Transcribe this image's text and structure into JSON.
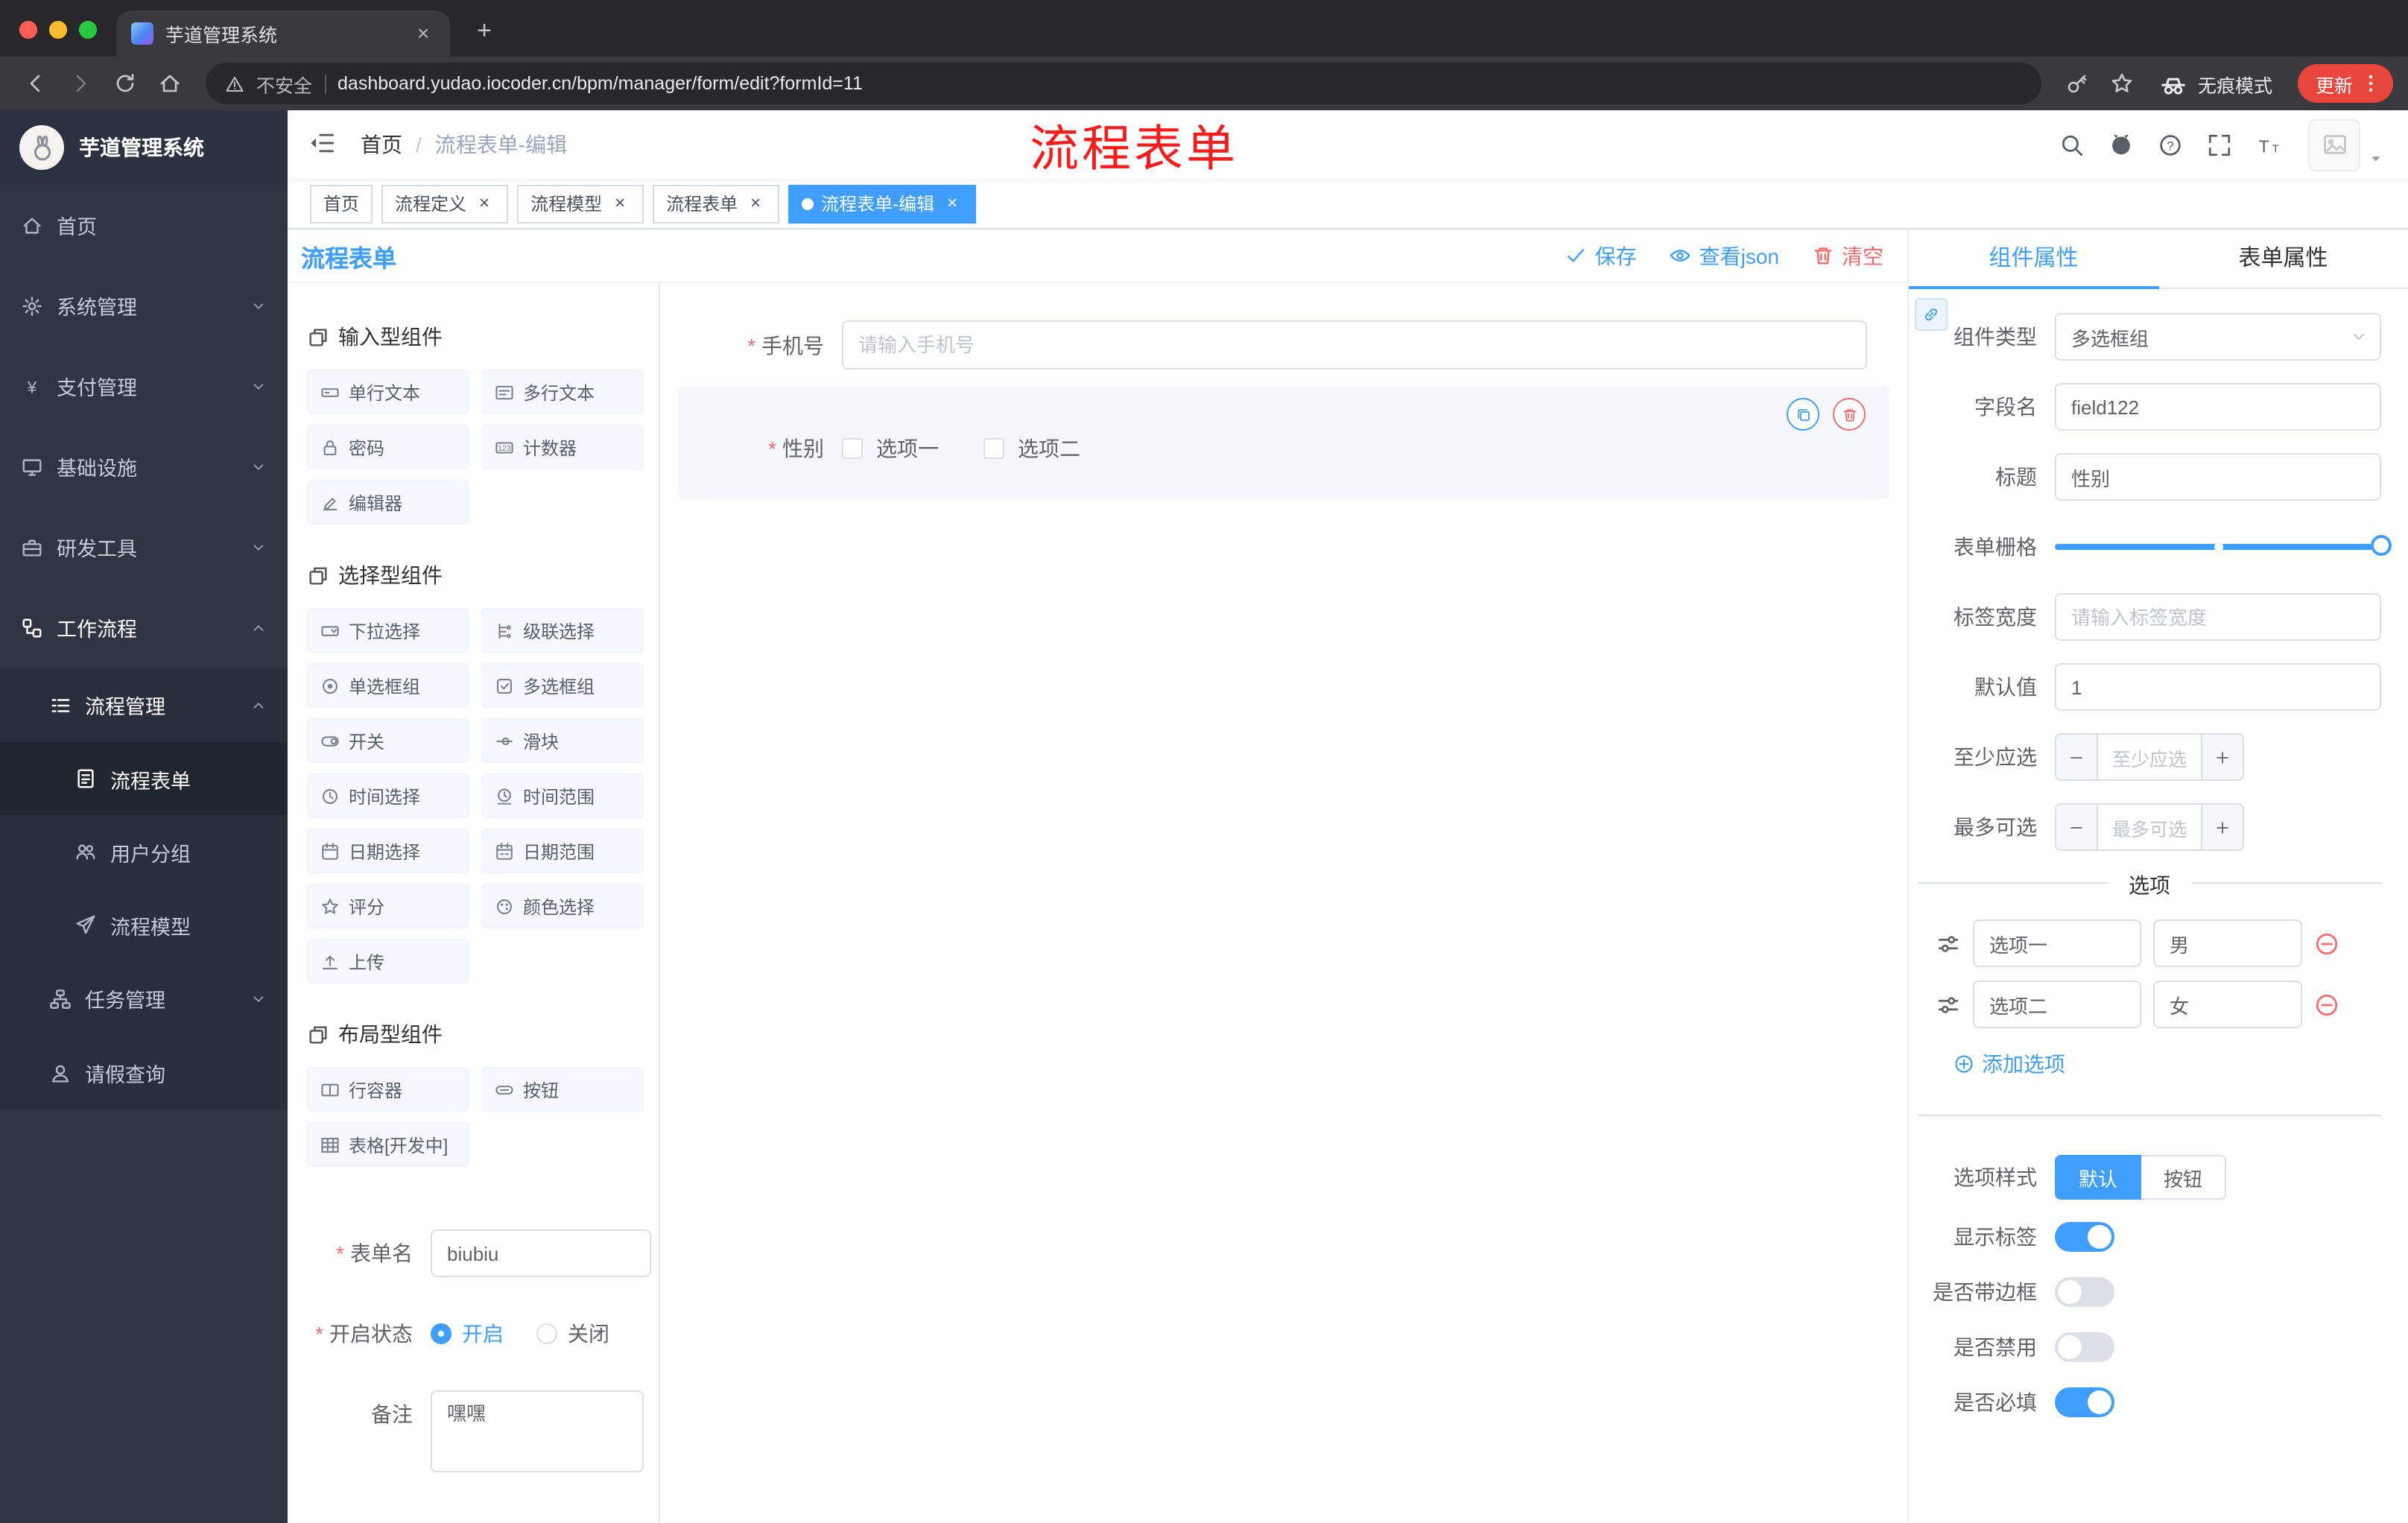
{
  "colors": {
    "accent": "#409eff",
    "danger": "#f56c6c",
    "annotation_red": "#fb1b1b",
    "active_tag_bg": "#409eff",
    "update_pill_bg": "#e8453c",
    "sidebar_bg": "#2f3542"
  },
  "icons": {
    "security": "warning-triangle",
    "incognito": "spy-glasses",
    "search": "magnifier",
    "github": "github-cat",
    "help": "question-circle",
    "fullscreen": "corner-brackets",
    "font_size": "Tt-letters",
    "hamburger": "fold-menu",
    "save": "check",
    "view_json": "eye",
    "clear": "trash",
    "copy_widget": "copy",
    "delete_widget": "trash",
    "add_option": "plus-circle",
    "remove_option": "minus-circle",
    "option_drag": "slider-handles"
  },
  "browser": {
    "tab_title": "芋道管理系统",
    "security_label": "不安全",
    "url": "dashboard.yudao.iocoder.cn/bpm/manager/form/edit?formId=11",
    "incognito_label": "无痕模式",
    "update_label": "更新"
  },
  "sidebar": {
    "logo_title": "芋道管理系统",
    "items": [
      {
        "label": "首页"
      },
      {
        "label": "系统管理"
      },
      {
        "label": "支付管理"
      },
      {
        "label": "基础设施"
      },
      {
        "label": "研发工具"
      },
      {
        "label": "工作流程"
      }
    ],
    "submenu": {
      "label": "流程管理",
      "children": [
        {
          "label": "流程表单"
        },
        {
          "label": "用户分组"
        },
        {
          "label": "流程模型"
        }
      ]
    },
    "extra": [
      {
        "label": "任务管理"
      },
      {
        "label": "请假查询"
      }
    ]
  },
  "navbar": {
    "breadcrumb": [
      "首页",
      "流程表单-编辑"
    ],
    "annotation": "流程表单"
  },
  "tags": [
    {
      "label": "首页"
    },
    {
      "label": "流程定义"
    },
    {
      "label": "流程模型"
    },
    {
      "label": "流程表单"
    },
    {
      "label": "流程表单-编辑"
    }
  ],
  "designer": {
    "title": "流程表单",
    "actions": {
      "save": "保存",
      "view_json": "查看json",
      "clear": "清空"
    },
    "palette": {
      "sections": [
        {
          "title": "输入型组件",
          "items": [
            "单行文本",
            "多行文本",
            "密码",
            "计数器",
            "编辑器"
          ]
        },
        {
          "title": "选择型组件",
          "items": [
            "下拉选择",
            "级联选择",
            "单选框组",
            "多选框组",
            "开关",
            "滑块",
            "时间选择",
            "时间范围",
            "日期选择",
            "日期范围",
            "评分",
            "颜色选择",
            "上传"
          ]
        },
        {
          "title": "布局型组件",
          "items": [
            "行容器",
            "按钮",
            "表格[开发中]"
          ]
        }
      ]
    },
    "meta": {
      "form_name_label": "表单名",
      "form_name_value": "biubiu",
      "status_label": "开启状态",
      "status_options": [
        "开启",
        "关闭"
      ],
      "status_selected": "开启",
      "remark_label": "备注",
      "remark_value": "嘿嘿"
    },
    "canvas": {
      "phone_label": "手机号",
      "phone_placeholder": "请输入手机号",
      "gender_label": "性别",
      "gender_options": [
        "选项一",
        "选项二"
      ]
    }
  },
  "props_panel": {
    "tabs": [
      "组件属性",
      "表单属性"
    ],
    "active_tab": "组件属性",
    "fields": {
      "component_type_label": "组件类型",
      "component_type_value": "多选框组",
      "field_name_label": "字段名",
      "field_name_value": "field122",
      "title_label": "标题",
      "title_value": "性别",
      "grid_label": "表单栅格",
      "label_width_label": "标签宽度",
      "label_width_placeholder": "请输入标签宽度",
      "default_label": "默认值",
      "default_value": "1",
      "min_label": "至少应选",
      "min_placeholder": "至少应选",
      "max_label": "最多可选",
      "max_placeholder": "最多可选"
    },
    "options_divider": "选项",
    "options": [
      {
        "label": "选项一",
        "value": "男"
      },
      {
        "label": "选项二",
        "value": "女"
      }
    ],
    "add_option": "添加选项",
    "style_label": "选项样式",
    "style_options": [
      "默认",
      "按钮"
    ],
    "style_selected": "默认",
    "switches": [
      {
        "label": "显示标签",
        "on": true
      },
      {
        "label": "是否带边框",
        "on": false
      },
      {
        "label": "是否禁用",
        "on": false
      },
      {
        "label": "是否必填",
        "on": true
      }
    ]
  }
}
